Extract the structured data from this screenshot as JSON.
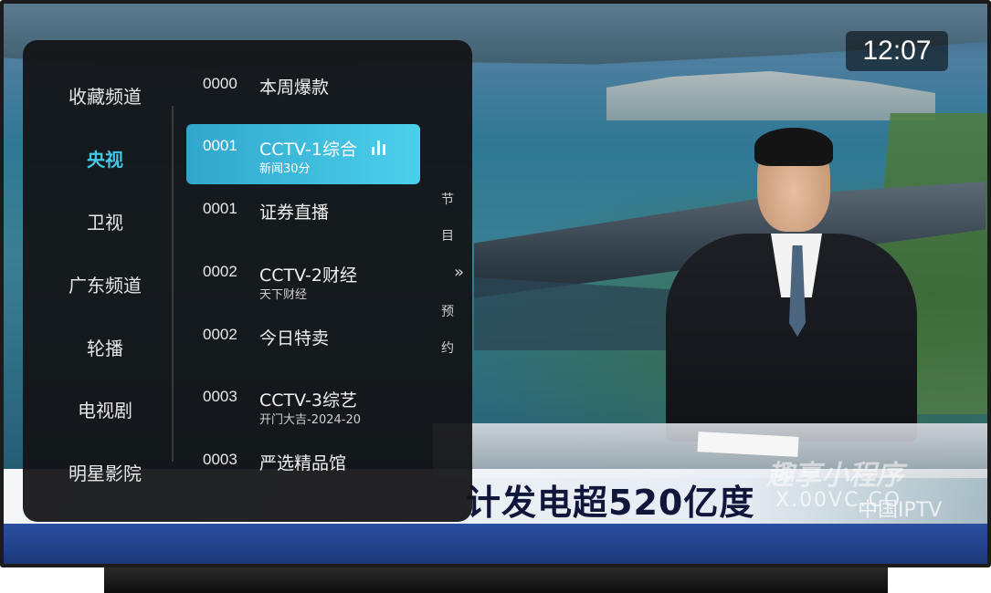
{
  "clock": {
    "time": "12:07"
  },
  "categories": [
    {
      "label": "收藏频道",
      "active": false
    },
    {
      "label": "央视",
      "active": true
    },
    {
      "label": "卫视",
      "active": false
    },
    {
      "label": "广东频道",
      "active": false
    },
    {
      "label": "轮播",
      "active": false
    },
    {
      "label": "电视剧",
      "active": false
    },
    {
      "label": "明星影院",
      "active": false
    }
  ],
  "channels": [
    {
      "number": "0000",
      "name": "本周爆款",
      "program": "",
      "active": false
    },
    {
      "number": "0001",
      "name": "CCTV-1综合",
      "program": "新闻30分",
      "active": true,
      "icon": "bars-icon"
    },
    {
      "number": "0001",
      "name": "证券直播",
      "program": "",
      "active": false
    },
    {
      "number": "0002",
      "name": "CCTV-2财经",
      "program": "天下财经",
      "active": false
    },
    {
      "number": "0002",
      "name": "今日特卖",
      "program": "",
      "active": false
    },
    {
      "number": "0003",
      "name": "CCTV-3综艺",
      "program": "开门大吉-2024-20",
      "active": false
    },
    {
      "number": "0003",
      "name": "严选精品馆",
      "program": "",
      "active": false
    }
  ],
  "side_tab": {
    "chars": [
      "节",
      "目",
      "预",
      "约"
    ],
    "chevron": "»"
  },
  "broadcast": {
    "caption": "计发电超520亿度",
    "watermark_app": "趣享小程序",
    "watermark_url": "X.00VC.CO",
    "watermark_brand": "中国IPTV"
  },
  "colors": {
    "accent": "#43c7e4",
    "active_item_start": "#31a6cc",
    "active_item_end": "#4bd0ec",
    "panel_bg": "#121214"
  }
}
